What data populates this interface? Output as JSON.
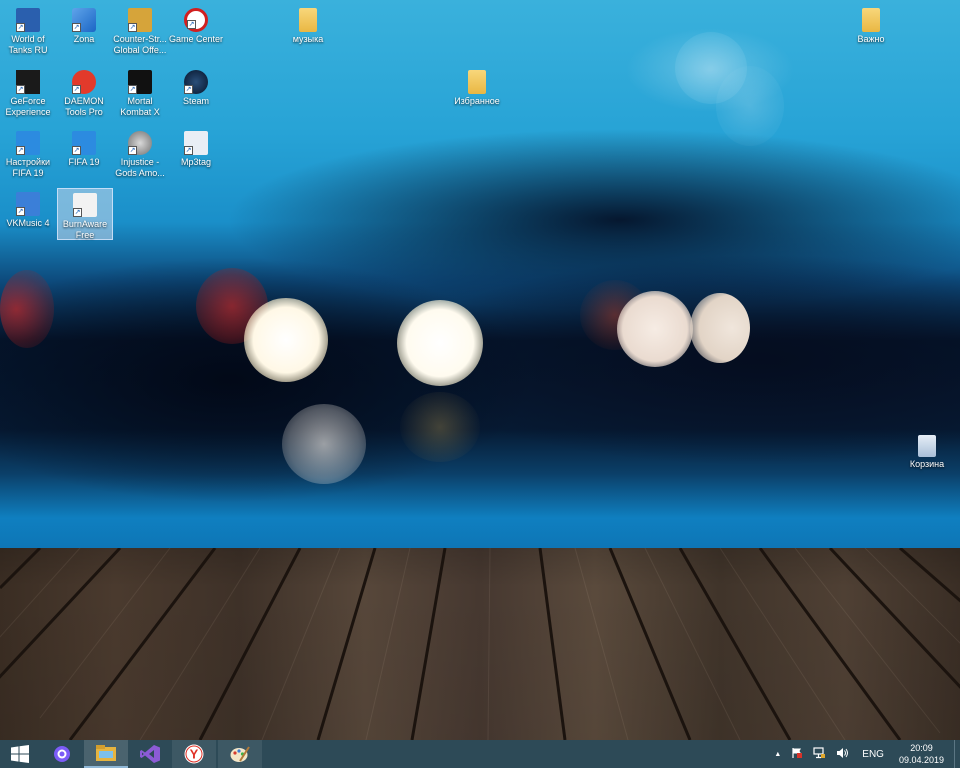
{
  "desktop": {
    "icons": [
      {
        "label": "World of Tanks RU",
        "icon": "world-of-tanks-icon"
      },
      {
        "label": "Zona",
        "icon": "zona-icon"
      },
      {
        "label": "Counter-Str... Global Offe...",
        "icon": "csgo-icon"
      },
      {
        "label": "Game Center",
        "icon": "game-center-icon"
      },
      {
        "label": "GeForce Experience",
        "icon": "geforce-icon"
      },
      {
        "label": "DAEMON Tools Pro",
        "icon": "daemon-tools-icon"
      },
      {
        "label": "Mortal Kombat X",
        "icon": "mortal-kombat-icon"
      },
      {
        "label": "Steam",
        "icon": "steam-icon"
      },
      {
        "label": "Настройки FIFA 19",
        "icon": "fifa-settings-icon"
      },
      {
        "label": "FIFA 19",
        "icon": "fifa-icon"
      },
      {
        "label": "Injustice - Gods Amo...",
        "icon": "injustice-icon"
      },
      {
        "label": "Mp3tag",
        "icon": "mp3tag-icon"
      },
      {
        "label": "VKMusic 4",
        "icon": "vkmusic-icon"
      },
      {
        "label": "BurnAware Free",
        "icon": "burnaware-icon",
        "selected": true
      },
      {
        "label": "музыка",
        "icon": "folder-icon"
      },
      {
        "label": "Избранное",
        "icon": "folder-icon"
      },
      {
        "label": "Важно",
        "icon": "folder-icon"
      },
      {
        "label": "Корзина",
        "icon": "recycle-bin-icon"
      }
    ]
  },
  "taskbar": {
    "start_icon": "windows-start-icon",
    "pinned": [
      {
        "name": "alice-assistant-icon"
      },
      {
        "name": "file-explorer-icon",
        "active": true
      },
      {
        "name": "visual-studio-icon"
      },
      {
        "name": "yandex-browser-icon",
        "glyph": "Y"
      },
      {
        "name": "paint-icon"
      }
    ],
    "tray": {
      "chevron": "▲",
      "language": "ENG",
      "time": "20:09",
      "date": "09.04.2019"
    }
  },
  "colors": {
    "taskbar": "#2d4a57",
    "sky": "#27a3d6"
  }
}
